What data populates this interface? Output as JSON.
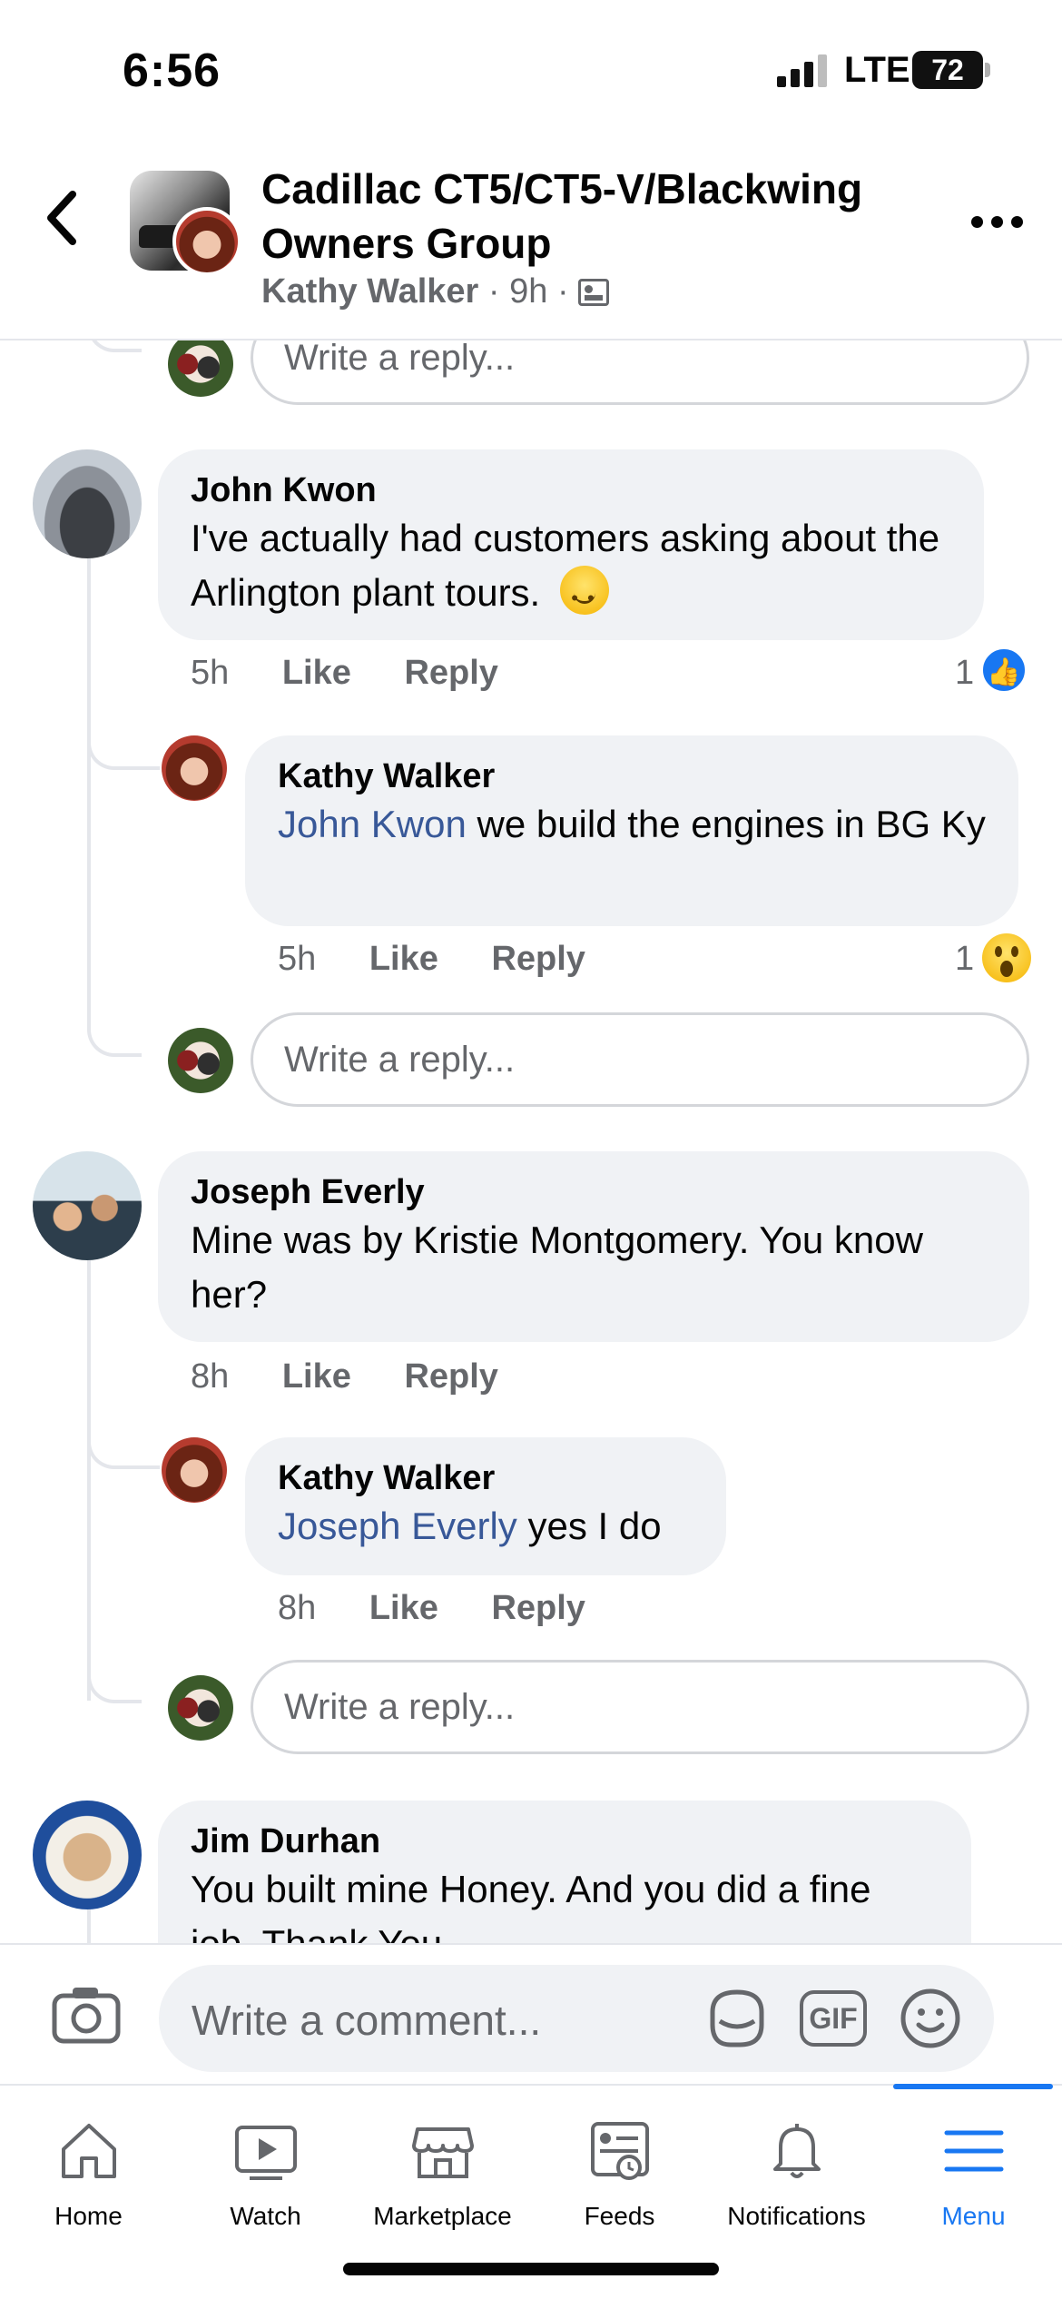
{
  "status_bar": {
    "time": "6:56",
    "network": "LTE",
    "battery": "72"
  },
  "header": {
    "group_title": "Cadillac CT5/CT5-V/Blackwing Owners Group",
    "author": "Kathy Walker",
    "separator": "·",
    "time": "9h",
    "audience_icon": "group-members-icon"
  },
  "reply_placeholder": "Write a reply...",
  "comments": [
    {
      "name": "John Kwon",
      "text": "I've actually had customers asking about the Arlington plant tours.",
      "emoji": "slightly-smiling-face",
      "time": "5h",
      "like_label": "Like",
      "reply_label": "Reply",
      "reaction_count": "1",
      "reaction_type": "like",
      "replies": [
        {
          "name": "Kathy Walker",
          "mention": "John Kwon",
          "text": " we build the engines in BG Ky",
          "time": "5h",
          "like_label": "Like",
          "reply_label": "Reply",
          "reaction_count": "1",
          "reaction_type": "wow"
        }
      ]
    },
    {
      "name": "Joseph Everly",
      "text": "Mine was by Kristie Montgomery. You know her?",
      "time": "8h",
      "like_label": "Like",
      "reply_label": "Reply",
      "replies": [
        {
          "name": "Kathy Walker",
          "mention": "Joseph Everly",
          "text": " yes I do",
          "time": "8h",
          "like_label": "Like",
          "reply_label": "Reply"
        }
      ]
    },
    {
      "name": "Jim Durhan",
      "text": "You built mine Honey. And you did a fine job. Thank You"
    }
  ],
  "composer": {
    "placeholder": "Write a comment...",
    "gif_label": "GIF"
  },
  "tabs": [
    {
      "label": "Home",
      "icon": "home-icon"
    },
    {
      "label": "Watch",
      "icon": "watch-icon"
    },
    {
      "label": "Marketplace",
      "icon": "marketplace-icon"
    },
    {
      "label": "Feeds",
      "icon": "feeds-icon"
    },
    {
      "label": "Notifications",
      "icon": "bell-icon"
    },
    {
      "label": "Menu",
      "icon": "menu-icon",
      "active": true
    }
  ],
  "colors": {
    "accent": "#1877f2",
    "mention": "#385898",
    "bubble": "#f0f2f5",
    "secondary_text": "#65676b"
  }
}
